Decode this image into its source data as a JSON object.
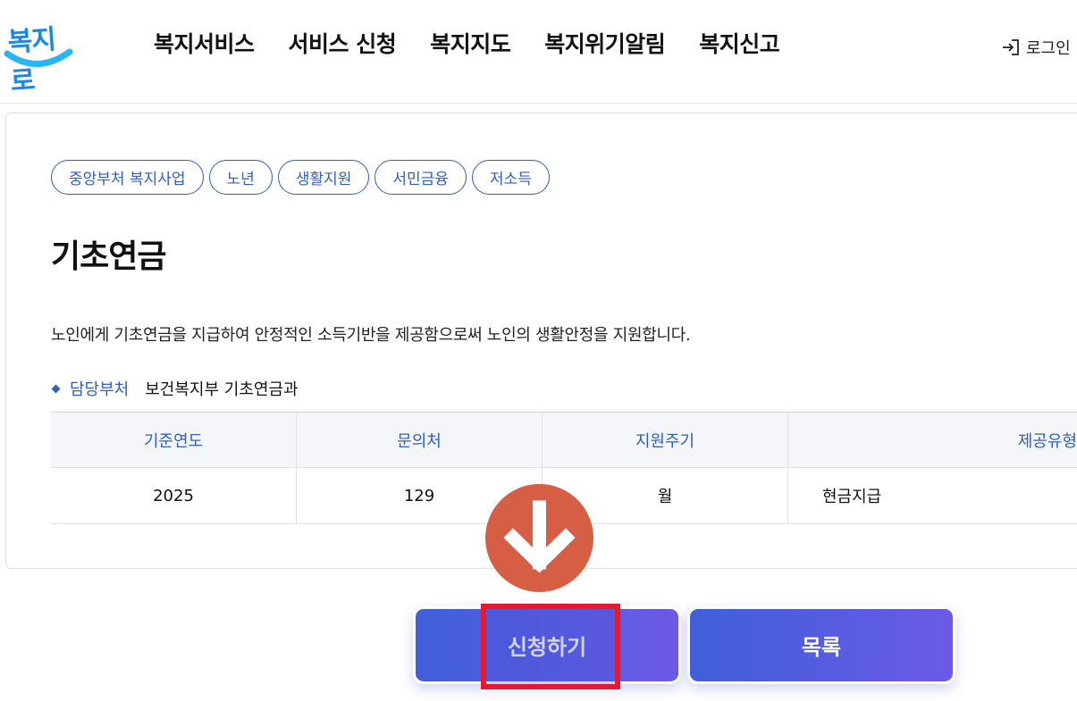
{
  "header": {
    "logo_text": "복지로",
    "nav": [
      "복지서비스",
      "서비스 신청",
      "복지지도",
      "복지위기알림",
      "복지신고"
    ],
    "login_label": "로그인"
  },
  "service": {
    "tags": [
      "중앙부처 복지사업",
      "노년",
      "생활지원",
      "서민금융",
      "저소득"
    ],
    "title": "기초연금",
    "description": "노인에게 기초연금을 지급하여 안정적인 소득기반을 제공함으로써 노인의 생활안정을 지원합니다.",
    "department_label": "담당부처",
    "department_value": "보건복지부 기초연금과"
  },
  "table": {
    "headers": [
      "기준연도",
      "문의처",
      "지원주기",
      "제공유형"
    ],
    "rows": [
      [
        "2025",
        "129",
        "월",
        "현금지급"
      ]
    ]
  },
  "actions": {
    "apply_label": "신청하기",
    "list_label": "목록"
  },
  "colors": {
    "accent": "#2f5fbf",
    "button_gradient_start": "#3f5fd8",
    "button_gradient_end": "#6b5ae6",
    "highlight": "#e8192c",
    "arrow_marker": "#d65e44",
    "logo": "#1e88e5"
  },
  "icons": {
    "login": "login-arrow-icon",
    "annotation": "down-arrow-icon"
  }
}
